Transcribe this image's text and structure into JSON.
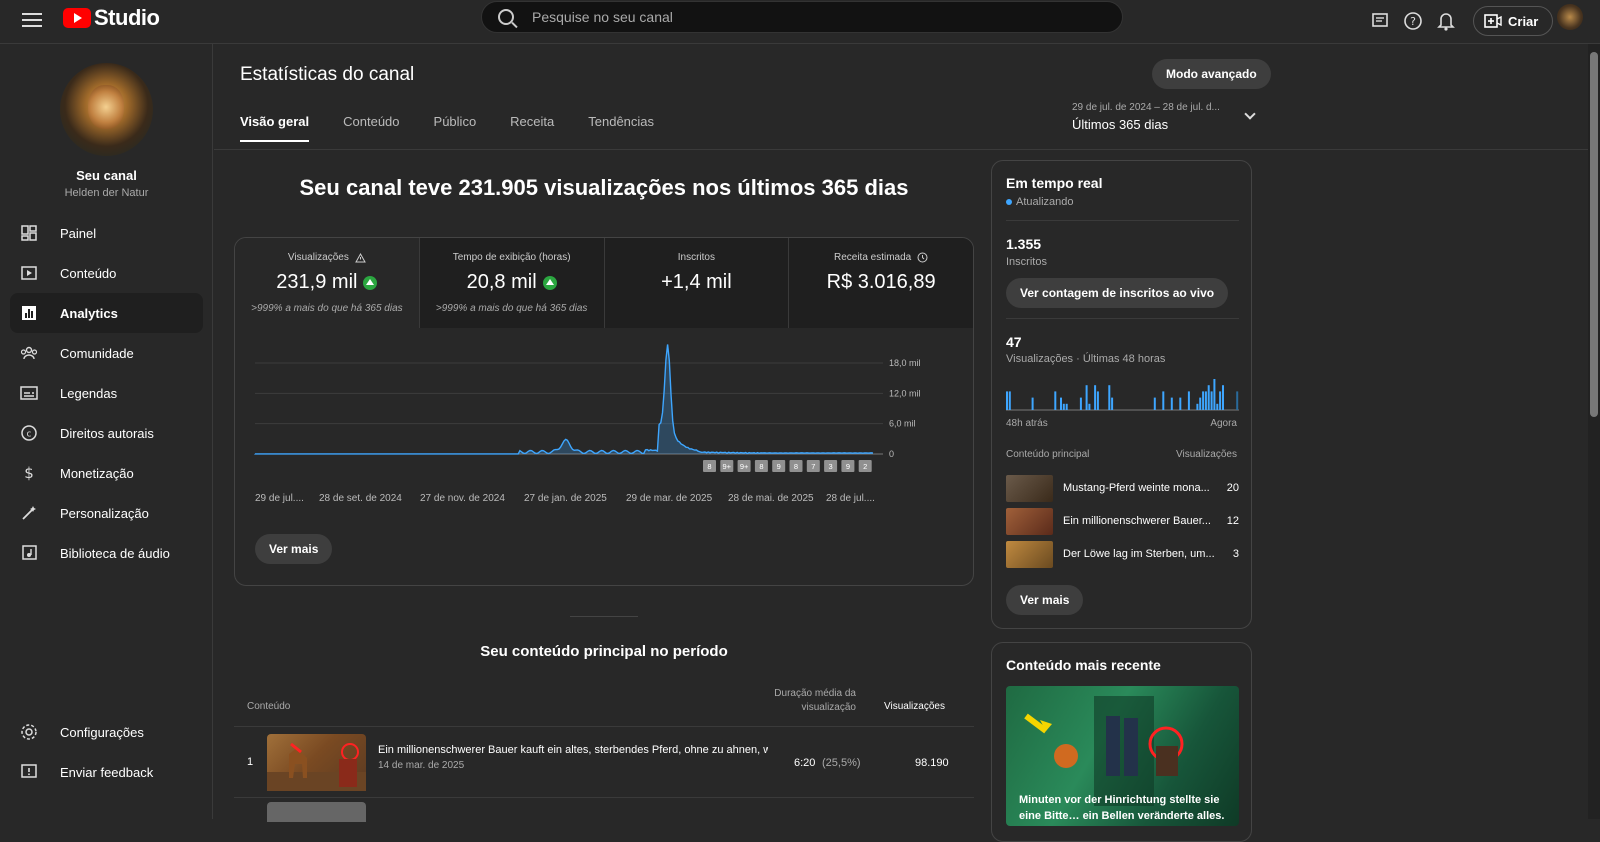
{
  "app": {
    "logo_text": "Studio"
  },
  "search": {
    "placeholder": "Pesquise no seu canal"
  },
  "header": {
    "create_label": "Criar"
  },
  "channel": {
    "title": "Seu canal",
    "name": "Helden der Natur"
  },
  "sidebar": {
    "items": [
      {
        "label": "Painel",
        "icon": "dashboard-icon"
      },
      {
        "label": "Conteúdo",
        "icon": "content-icon"
      },
      {
        "label": "Analytics",
        "icon": "analytics-icon",
        "active": true
      },
      {
        "label": "Comunidade",
        "icon": "community-icon"
      },
      {
        "label": "Legendas",
        "icon": "subtitles-icon"
      },
      {
        "label": "Direitos autorais",
        "icon": "copyright-icon"
      },
      {
        "label": "Monetização",
        "icon": "monetization-icon"
      },
      {
        "label": "Personalização",
        "icon": "customization-icon"
      },
      {
        "label": "Biblioteca de áudio",
        "icon": "audio-library-icon"
      }
    ],
    "bottom": [
      {
        "label": "Configurações",
        "icon": "settings-icon"
      },
      {
        "label": "Enviar feedback",
        "icon": "feedback-icon"
      }
    ]
  },
  "page": {
    "title": "Estatísticas do canal",
    "advanced_label": "Modo avançado",
    "tabs": [
      "Visão geral",
      "Conteúdo",
      "Público",
      "Receita",
      "Tendências"
    ],
    "date_range_small": "29 de jul. de 2024 – 28 de jul. d...",
    "date_range": "Últimos 365 dias"
  },
  "overview": {
    "headline": "Seu canal teve 231.905 visualizações nos últimos 365 dias",
    "metrics": [
      {
        "label": "Visualizações",
        "value": "231,9 mil",
        "note": ">999% a mais do que há 365 dias"
      },
      {
        "label": "Tempo de exibição (horas)",
        "value": "20,8 mil",
        "note": ">999% a mais do que há 365 dias"
      },
      {
        "label": "Inscritos",
        "value": "+1,4 mil",
        "note": ""
      },
      {
        "label": "Receita estimada",
        "value": "R$ 3.016,89",
        "note": ""
      }
    ],
    "see_more": "Ver mais"
  },
  "chart_data": {
    "type": "area",
    "ylim": [
      0,
      18000
    ],
    "y_ticks": [
      "18,0 mil",
      "12,0 mil",
      "6,0 mil",
      "0"
    ],
    "x_labels": [
      "29 de jul....",
      "28 de set. de 2024",
      "27 de nov. de 2024",
      "27 de jan. de 2025",
      "29 de mar. de 2025",
      "28 de mai. de 2025",
      "28 de jul...."
    ],
    "values": [
      0,
      0,
      0,
      0,
      0,
      0,
      0,
      0,
      0,
      0,
      0,
      0,
      0,
      0,
      0,
      0,
      0,
      0,
      0,
      0,
      0,
      0,
      0,
      0,
      0,
      0,
      0,
      0,
      0,
      0,
      0,
      0,
      0,
      0,
      0,
      0,
      0,
      0,
      0,
      0,
      0,
      0,
      0,
      0,
      0,
      0,
      0,
      0,
      0,
      0,
      0,
      0,
      0,
      0,
      0,
      0,
      0,
      0,
      0,
      0,
      0,
      0,
      0,
      0,
      0,
      0,
      0,
      0,
      0,
      0,
      0,
      0,
      0,
      0,
      0,
      0,
      0,
      0,
      0,
      0,
      0,
      0,
      0,
      0,
      0,
      0,
      0,
      0,
      0,
      0,
      0,
      0,
      0,
      0,
      0,
      0,
      0,
      0,
      0,
      0,
      0,
      0,
      0,
      0,
      0,
      0,
      0,
      0,
      0,
      0,
      0,
      0,
      0,
      0,
      0,
      0,
      0,
      0,
      0,
      0,
      0,
      0,
      0,
      0,
      0,
      0,
      0,
      0,
      0,
      0,
      0,
      0,
      0,
      0,
      0,
      0,
      0,
      0,
      0,
      0,
      0,
      0,
      0,
      0,
      0,
      0,
      0,
      0,
      0,
      0,
      0,
      0,
      0,
      0,
      0,
      0,
      0,
      0,
      0,
      0,
      0,
      0,
      0,
      0,
      0,
      0,
      0,
      0,
      0,
      0,
      0,
      0,
      0,
      0,
      0,
      0,
      0,
      0,
      0,
      0,
      0,
      0,
      0,
      0,
      0,
      0,
      0,
      0,
      0,
      0,
      0,
      0,
      0,
      0,
      0,
      0,
      0,
      0,
      0,
      0,
      0,
      0,
      0,
      0,
      0,
      0,
      0,
      0,
      0,
      0,
      0,
      0,
      0,
      0,
      0,
      0,
      0,
      0,
      0,
      0,
      0,
      0,
      0,
      0,
      0,
      0,
      0,
      0,
      0,
      0,
      0,
      0,
      0,
      0,
      0,
      0,
      0,
      0,
      0,
      0,
      0,
      0,
      0,
      0,
      0,
      0,
      0,
      0,
      0,
      0,
      0,
      0,
      0,
      0,
      0,
      0,
      0,
      0,
      0,
      0,
      0,
      0,
      0,
      0,
      0,
      0,
      0,
      0,
      0,
      0,
      0,
      0,
      0,
      0,
      0,
      0,
      0,
      0,
      0,
      0,
      0,
      0,
      0,
      0,
      0,
      0,
      0,
      0,
      0,
      0,
      0,
      0,
      0,
      0,
      0,
      0,
      0,
      0,
      0,
      0,
      0,
      0,
      0,
      0,
      0,
      0,
      0,
      0,
      0,
      0,
      0,
      0,
      0,
      0,
      0,
      0,
      0,
      0,
      0,
      0,
      0,
      0,
      0,
      0,
      0,
      0,
      0,
      0,
      0,
      0,
      0,
      0,
      0,
      0,
      0,
      0,
      0,
      0,
      0,
      0,
      0,
      0,
      0,
      0,
      0,
      0,
      0,
      0,
      0,
      0,
      0,
      0,
      0,
      0,
      0,
      0,
      0,
      0,
      0,
      0,
      0,
      0,
      0,
      0,
      0,
      0,
      0,
      0,
      0,
      0,
      0,
      0,
      0,
      0,
      0,
      0,
      0,
      0,
      0,
      0,
      0,
      0,
      0,
      0,
      0,
      0,
      0,
      0,
      0,
      0,
      0,
      0,
      0,
      0,
      0,
      0,
      0,
      0,
      0,
      0,
      0,
      0,
      0,
      0,
      0,
      0,
      0,
      0,
      0,
      0,
      0,
      0,
      0,
      0,
      0
    ],
    "badges": [
      "8",
      "9+",
      "9+",
      "8",
      "9",
      "8",
      "7",
      "3",
      "9",
      "2"
    ]
  },
  "top_content": {
    "title": "Seu conteúdo principal no período",
    "col_content": "Conteúdo",
    "col_duration": "Duração média da visualização",
    "col_views": "Visualizações",
    "rows": [
      {
        "rank": "1",
        "title": "Ein millionenschwerer Bauer kauft ein altes, sterbendes Pferd, ohne zu ahnen, we...",
        "date": "14 de mar. de 2025",
        "duration": "6:20",
        "pct": "(25,5%)",
        "views": "98.190"
      }
    ]
  },
  "realtime": {
    "title": "Em tempo real",
    "status": "Atualizando",
    "subs_value": "1.355",
    "subs_label": "Inscritos",
    "live_count_btn": "Ver contagem de inscritos ao vivo",
    "views_value": "47",
    "views_label": "Visualizações · Últimas 48 horas",
    "bars": [
      3,
      3,
      0,
      0,
      0,
      0,
      0,
      0,
      0,
      2,
      0,
      0,
      0,
      0,
      0,
      0,
      0,
      3,
      0,
      2,
      1,
      1,
      0,
      0,
      0,
      0,
      2,
      0,
      4,
      1,
      0,
      4,
      3,
      0,
      0,
      0,
      4,
      2,
      0,
      0,
      0,
      0,
      0,
      0,
      0,
      0,
      0,
      0,
      0,
      0,
      0,
      0,
      2,
      0,
      0,
      3,
      0,
      0,
      2,
      0,
      0,
      2,
      0,
      0,
      3,
      0,
      0,
      1,
      2,
      3,
      3,
      4,
      3,
      5,
      1,
      3,
      4,
      0,
      0,
      0,
      0,
      3
    ],
    "axis_left": "48h atrás",
    "axis_right": "Agora",
    "col_content": "Conteúdo principal",
    "col_views": "Visualizações",
    "rows": [
      {
        "title": "Mustang-Pferd weinte mona...",
        "views": "20"
      },
      {
        "title": "Ein millionenschwerer Bauer...",
        "views": "12"
      },
      {
        "title": "Der Löwe lag im Sterben, um...",
        "views": "3"
      }
    ],
    "see_more": "Ver mais"
  },
  "recent": {
    "title": "Conteúdo mais recente",
    "caption": "Minuten vor der Hinrichtung stellte sie eine Bitte… ein Bellen veränderte alles."
  }
}
